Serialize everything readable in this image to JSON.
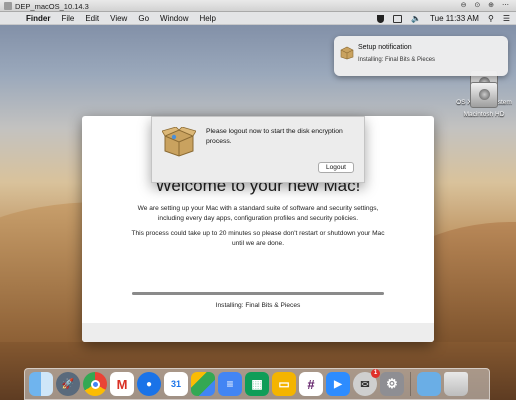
{
  "vm": {
    "title": "DEP_macOS_10.14.3",
    "controls": "⊖ ⊙ ⊕ ⋯"
  },
  "menubar": {
    "apple_icon": "",
    "app_name": "Finder",
    "menus": [
      "File",
      "Edit",
      "View",
      "Go",
      "Window",
      "Help"
    ],
    "clock": "Tue 11:33 AM"
  },
  "notification": {
    "title": "Setup notification",
    "subtitle": "Installing: Final Bits & Pieces"
  },
  "desktop_icons": [
    {
      "label": "OS X Base System"
    },
    {
      "label": "Macintosh HD"
    }
  ],
  "dep": {
    "heading": "Welcome to your new Mac!",
    "paragraph1": "We are setting up your Mac with a standard suite of software and security settings, including every day apps, configuration profiles and security policies.",
    "paragraph2": "This process could take up to 20 minutes so please don't restart or shutdown your Mac until we are done.",
    "progress": 1.0,
    "status": "Installing: Final Bits & Pieces"
  },
  "alert": {
    "message": "Please logout now to start the disk encryption process.",
    "button": "Logout"
  },
  "dock": {
    "calendar_day": "31",
    "mail_badge": "1"
  }
}
